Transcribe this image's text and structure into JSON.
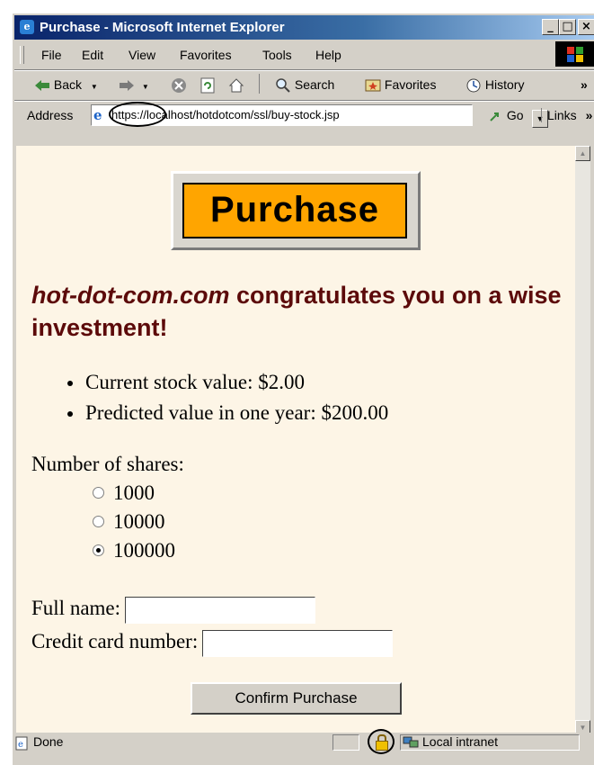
{
  "window": {
    "title": "Purchase - Microsoft Internet Explorer",
    "controls": [
      "_",
      "□",
      "×"
    ]
  },
  "menu": [
    "File",
    "Edit",
    "View",
    "Favorites",
    "Tools",
    "Help"
  ],
  "toolbar": {
    "back": "Back",
    "search": "Search",
    "favorites": "Favorites",
    "history": "History",
    "more": "»"
  },
  "address": {
    "label": "Address",
    "url": "https://localhost/hotdotcom/ssl/buy-stock.jsp",
    "go": "Go",
    "links": "Links",
    "links_more": "»"
  },
  "page": {
    "logo_text": "Purchase",
    "headline_company": "hot-dot-com.com",
    "headline_rest": " congratulates you on a wise investment!",
    "bullets": [
      "Current stock value: $2.00",
      "Predicted value in one year: $200.00"
    ],
    "shares_label": "Number of shares:",
    "share_options": [
      {
        "label": "1000",
        "checked": false
      },
      {
        "label": "10000",
        "checked": false
      },
      {
        "label": "100000",
        "checked": true
      }
    ],
    "full_name_label": "Full name:",
    "full_name_value": "",
    "credit_card_label": "Credit card number:",
    "credit_card_value": "",
    "confirm_button": "Confirm Purchase"
  },
  "status": {
    "text": "Done",
    "zone": "Local intranet"
  },
  "icons": {
    "back": "back-arrow-icon",
    "forward": "forward-arrow-icon",
    "stop": "stop-icon",
    "refresh": "refresh-icon",
    "home": "home-icon",
    "search": "search-icon",
    "favorites": "favorites-icon",
    "history": "history-icon",
    "lock": "padlock-icon",
    "ie": "internet-explorer-icon",
    "zone": "local-intranet-icon"
  },
  "colors": {
    "page_background": "#fdf5e6",
    "logo_background": "#ffa500",
    "headline": "#5c0a0a",
    "titlebar": "#0a246a"
  }
}
